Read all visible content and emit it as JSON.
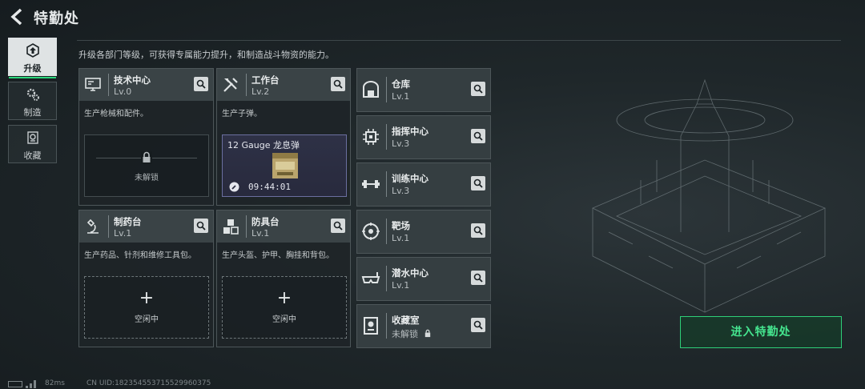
{
  "header": {
    "back_icon": "back-arrow-icon",
    "title": "特勤处"
  },
  "subtitle": "升级各部门等级，可获得专属能力提升，和制造战斗物资的能力。",
  "sidebar": {
    "tabs": [
      {
        "label": "升级",
        "icon": "upgrade-icon",
        "active": true
      },
      {
        "label": "制造",
        "icon": "gears-icon",
        "active": false
      },
      {
        "label": "收藏",
        "icon": "collection-icon",
        "active": false
      }
    ]
  },
  "departments": [
    {
      "name": "技术中心",
      "level": "Lv.0",
      "icon": "monitor-icon",
      "desc": "生产枪械和配件。",
      "slot": {
        "state": "locked",
        "text": "未解锁"
      }
    },
    {
      "name": "工作台",
      "level": "Lv.2",
      "icon": "tools-icon",
      "desc": "生产子弹。",
      "slot": {
        "state": "crafting",
        "item": "12 Gauge 龙息弹",
        "timer": "09:44:01"
      }
    },
    {
      "name": "制药台",
      "level": "Lv.1",
      "icon": "microscope-icon",
      "desc": "生产药品、针剂和维修工具包。",
      "slot": {
        "state": "idle",
        "plus": "+",
        "text": "空闲中"
      }
    },
    {
      "name": "防具台",
      "level": "Lv.1",
      "icon": "cubes-icon",
      "desc": "生产头盔、护甲、胸挂和背包。",
      "slot": {
        "state": "idle",
        "plus": "+",
        "text": "空闲中"
      }
    }
  ],
  "facilities": [
    {
      "name": "仓库",
      "level": "Lv.1",
      "icon": "warehouse-icon"
    },
    {
      "name": "指挥中心",
      "level": "Lv.3",
      "icon": "chip-icon"
    },
    {
      "name": "训练中心",
      "level": "Lv.3",
      "icon": "dumbbell-icon"
    },
    {
      "name": "靶场",
      "level": "Lv.1",
      "icon": "target-icon"
    },
    {
      "name": "潜水中心",
      "level": "Lv.1",
      "icon": "diving-mask-icon"
    },
    {
      "name": "收藏室",
      "level": "未解锁",
      "icon": "trophy-room-icon",
      "locked": true
    }
  ],
  "enter_button": "进入特勤处",
  "footer": {
    "ping": "82ms",
    "uid": "CN UID:18235455371552996037​5"
  },
  "colors": {
    "accent": "#2ecf78",
    "panel": "#353e41",
    "background": "#1b2225"
  }
}
